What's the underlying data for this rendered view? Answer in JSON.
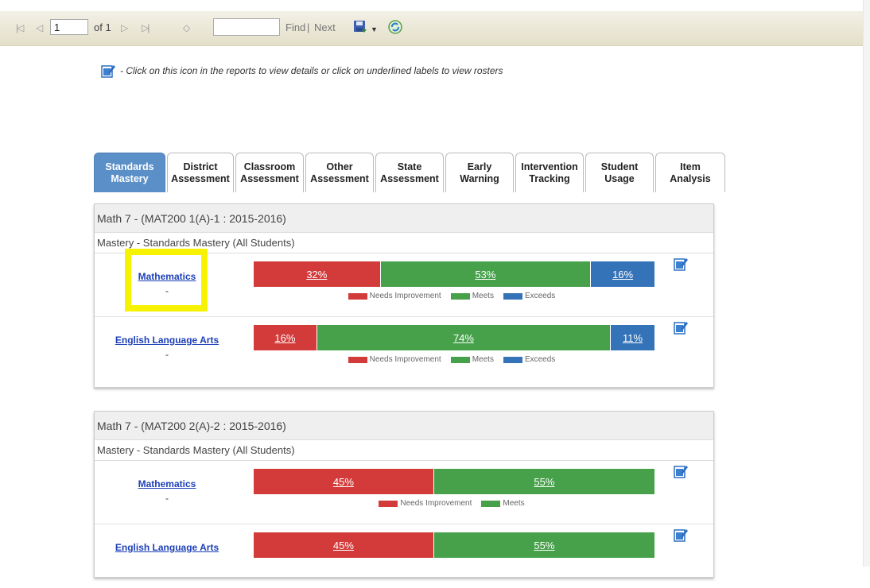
{
  "toolbar": {
    "page_value": "1",
    "page_of": "of 1",
    "find_label": "Find",
    "separator": "|",
    "next_label": "Next"
  },
  "hint": {
    "text": "- Click on this icon in the reports to view details or click on underlined labels to view rosters"
  },
  "tabs": [
    {
      "label": "Standards\nMastery",
      "active": true
    },
    {
      "label": "District\nAssessment",
      "active": false
    },
    {
      "label": "Classroom\nAssessment",
      "active": false
    },
    {
      "label": "Other\nAssessment",
      "active": false
    },
    {
      "label": "State\nAssessment",
      "active": false
    },
    {
      "label": "Early\nWarning",
      "active": false
    },
    {
      "label": "Intervention\nTracking",
      "active": false
    },
    {
      "label": "Student\nUsage",
      "active": false
    },
    {
      "label": "Item\nAnalysis",
      "active": false
    }
  ],
  "legend": {
    "needs_improvement": "Needs Improvement",
    "meets": "Meets",
    "exceeds": "Exceeds"
  },
  "colors": {
    "needs_improvement": "#d33b3b",
    "meets": "#46a14a",
    "exceeds": "#3573b8",
    "highlight": "#f7f300"
  },
  "panels": [
    {
      "title": "Math 7 - (MAT200 1(A)-1 : 2015-2016)",
      "subtitle": "Mastery - Standards Mastery (All Students)",
      "rows": [
        {
          "subject": "Mathematics",
          "dash": "-",
          "ni": 32,
          "meets": 53,
          "exceeds": 16,
          "ni_label": "32%",
          "meets_label": "53%",
          "exceeds_label": "16%"
        },
        {
          "subject": "English Language Arts",
          "dash": "-",
          "ni": 16,
          "meets": 74,
          "exceeds": 11,
          "ni_label": "16%",
          "meets_label": "74%",
          "exceeds_label": "11%"
        }
      ]
    },
    {
      "title": "Math 7 - (MAT200 2(A)-2 : 2015-2016)",
      "subtitle": "Mastery - Standards Mastery (All Students)",
      "rows": [
        {
          "subject": "Mathematics",
          "dash": "-",
          "ni": 45,
          "meets": 55,
          "ni_label": "45%",
          "meets_label": "55%"
        },
        {
          "subject": "English Language Arts",
          "dash": "",
          "ni": 45,
          "meets": 55,
          "ni_label": "45%",
          "meets_label": "55%"
        }
      ]
    }
  ]
}
